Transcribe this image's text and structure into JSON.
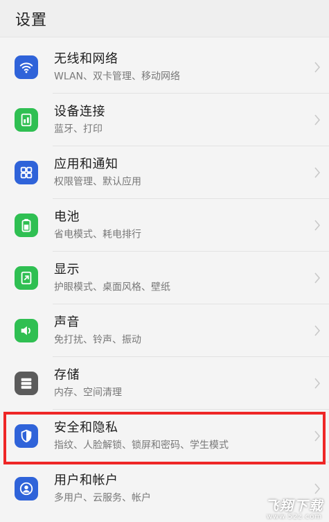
{
  "header": {
    "title": "设置"
  },
  "items": [
    {
      "title": "无线和网络",
      "subtitle": "WLAN、双卡管理、移动网络",
      "icon": "wifi-icon",
      "color": "#2f63d9"
    },
    {
      "title": "设备连接",
      "subtitle": "蓝牙、打印",
      "icon": "device-connection-icon",
      "color": "#2fbf52"
    },
    {
      "title": "应用和通知",
      "subtitle": "权限管理、默认应用",
      "icon": "apps-grid-icon",
      "color": "#2f63d9"
    },
    {
      "title": "电池",
      "subtitle": "省电模式、耗电排行",
      "icon": "battery-icon",
      "color": "#2fbf52"
    },
    {
      "title": "显示",
      "subtitle": "护眼模式、桌面风格、壁纸",
      "icon": "display-icon",
      "color": "#2fbf52"
    },
    {
      "title": "声音",
      "subtitle": "免打扰、铃声、振动",
      "icon": "speaker-icon",
      "color": "#2fbf52"
    },
    {
      "title": "存储",
      "subtitle": "内存、空间清理",
      "icon": "storage-icon",
      "color": "#5b5b5b"
    },
    {
      "title": "安全和隐私",
      "subtitle": "指纹、人脸解锁、锁屏和密码、学生模式",
      "icon": "shield-icon",
      "color": "#2f63d9"
    },
    {
      "title": "用户和帐户",
      "subtitle": "多用户、云服务、帐户",
      "icon": "user-icon",
      "color": "#2f63d9"
    }
  ],
  "highlight_color": "#ee2626",
  "watermark": {
    "main": "飞翔下载",
    "sub": "www.52z.com"
  }
}
